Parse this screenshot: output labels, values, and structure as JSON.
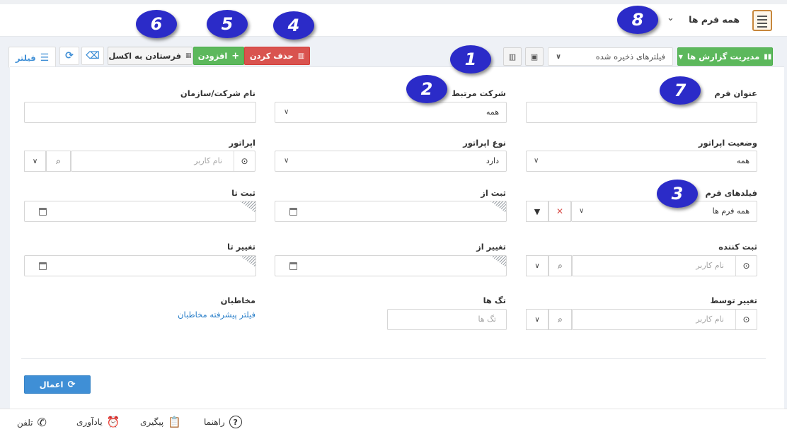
{
  "header": {
    "title": "همه فرم ها",
    "dropdown_caret": "⌄"
  },
  "toolbar": {
    "report_manage_label": "مدیریت گزارش ها",
    "saved_filters_label": "فیلترهای ذخیره شده",
    "delete_label": "حذف کردن",
    "add_label": "افزودن",
    "export_label": "فرستادن به اکسل",
    "filter_label": "فیلتر"
  },
  "form": {
    "form_title_label": "عنوان فرم",
    "related_company_label": "شرکت مرتبط",
    "related_company_value": "همه",
    "company_name_label": "نام شرکت/سازمان",
    "operator_status_label": "وضعیت اپراتور",
    "operator_status_value": "همه",
    "operator_type_label": "نوع اپراتور",
    "operator_type_value": "دارد",
    "operator_label": "اپراتور",
    "operator_placeholder": "نام کاربر",
    "form_fields_label": "فیلدهای فرم",
    "form_fields_value": "همه فرم ها",
    "created_from_label": "ثبت از",
    "created_to_label": "ثبت تا",
    "creator_label": "ثبت کننده",
    "creator_placeholder": "نام کاربر",
    "changed_from_label": "تغییر از",
    "changed_to_label": "تغییر تا",
    "changed_by_label": "تغییر توسط",
    "changed_by_placeholder": "نام کاربر",
    "tags_label": "تگ ها",
    "tags_placeholder": "تگ ها",
    "contacts_label": "مخاطبان",
    "contacts_link": "فیلتر پیشرفته مخاطبان",
    "apply_label": "اعمال"
  },
  "bottom_bar": {
    "guide": "راهنما",
    "followup": "پیگیری",
    "reminder": "یادآوری",
    "phone": "تلفن"
  },
  "annotations": [
    "1",
    "2",
    "3",
    "4",
    "5",
    "6",
    "7",
    "8"
  ],
  "colors": {
    "green": "#5cb85c",
    "red": "#d9534f",
    "blue_apply": "#3f8fd6",
    "badge": "#2b2bc8",
    "link": "#2a7fc9"
  }
}
